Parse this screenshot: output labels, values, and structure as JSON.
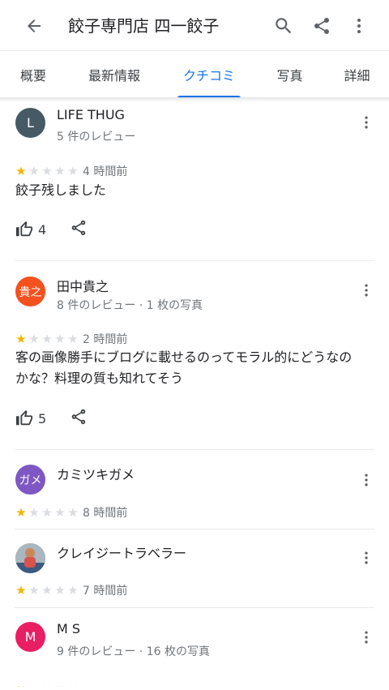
{
  "header": {
    "title": "餃子専門店 四一餃子",
    "icons": [
      "back-arrow-icon",
      "search-icon",
      "share-icon",
      "more-vert-icon"
    ]
  },
  "tabs": [
    {
      "label": "概要",
      "active": false
    },
    {
      "label": "最新情報",
      "active": false
    },
    {
      "label": "クチコミ",
      "active": true
    },
    {
      "label": "写真",
      "active": false
    },
    {
      "label": "詳細",
      "active": false
    }
  ],
  "colors": {
    "accent": "#1a73e8",
    "star": "#f4b400",
    "star_off": "#dadce0"
  },
  "reviews": [
    {
      "avatar_letter": "L",
      "avatar_color": "#455a64",
      "name": "LIFE THUG",
      "sub": "5 件のレビュー",
      "rating": 1,
      "time": "4 時間前",
      "text": "餃子残しました",
      "likes": "4"
    },
    {
      "avatar_letter": "貴之",
      "avatar_color": "#f4511e",
      "name": "田中貴之",
      "sub": "8 件のレビュー · 1 枚の写真",
      "rating": 1,
      "time": "2 時間前",
      "text": "客の画像勝手にブログに載せるのってモラル的にどうなのかな？料理の質も知れてそう",
      "likes": "5"
    },
    {
      "avatar_letter": "ガメ",
      "avatar_color": "#7e57c2",
      "name": "カミツキガメ",
      "sub": "",
      "rating": 1,
      "time": "8 時間前"
    },
    {
      "avatar_letter": "",
      "avatar_color": "#6d7b8a",
      "name": "クレイジートラベラー",
      "sub": "",
      "rating": 1,
      "time": "7 時間前"
    },
    {
      "avatar_letter": "M",
      "avatar_color": "#e91e63",
      "name": "M S",
      "sub": "9 件のレビュー · 16 枚の写真",
      "rating": 1
    }
  ]
}
